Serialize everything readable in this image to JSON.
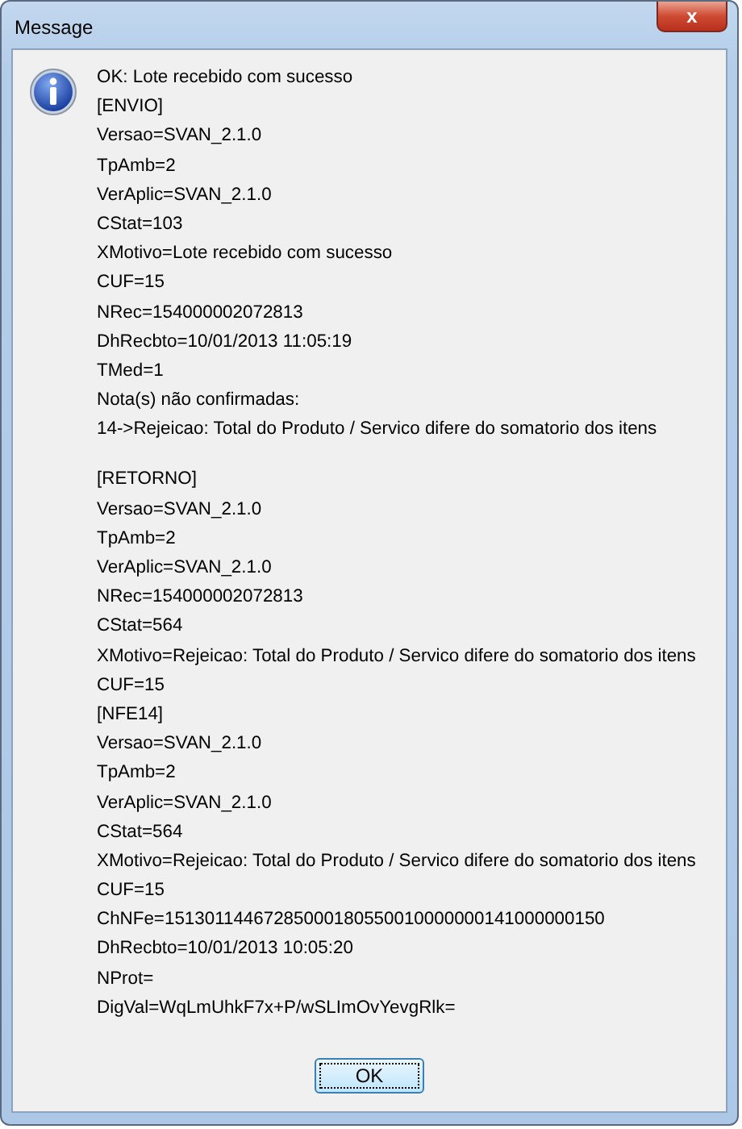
{
  "window": {
    "title": "Message",
    "close_label": "x"
  },
  "message": {
    "kind": "info",
    "paragraphs": [
      [
        "OK: Lote recebido com sucesso",
        "[ENVIO]",
        "Versao=SVAN_2.1.0",
        "TpAmb=2",
        "VerAplic=SVAN_2.1.0",
        "CStat=103",
        "XMotivo=Lote recebido com sucesso",
        "CUF=15",
        "NRec=154000002072813",
        "DhRecbto=10/01/2013 11:05:19",
        "TMed=1",
        "Nota(s) não confirmadas:",
        "14->Rejeicao: Total do Produto / Servico difere do somatorio dos itens"
      ],
      [
        "[RETORNO]",
        "Versao=SVAN_2.1.0",
        "TpAmb=2",
        "VerAplic=SVAN_2.1.0",
        "NRec=154000002072813",
        "CStat=564",
        "XMotivo=Rejeicao: Total do Produto / Servico difere do somatorio dos itens",
        "CUF=15",
        "[NFE14]",
        "Versao=SVAN_2.1.0",
        "TpAmb=2",
        "VerAplic=SVAN_2.1.0",
        "CStat=564",
        "XMotivo=Rejeicao: Total do Produto / Servico difere do somatorio dos itens",
        "CUF=15",
        "ChNFe=15130114467285000180550010000000141000000150",
        "DhRecbto=10/01/2013 10:05:20",
        "NProt=",
        "DigVal=WqLmUhkF7x+P/wSLImOvYevgRlk="
      ]
    ]
  },
  "buttons": [
    {
      "label": "OK",
      "focused": true
    }
  ]
}
